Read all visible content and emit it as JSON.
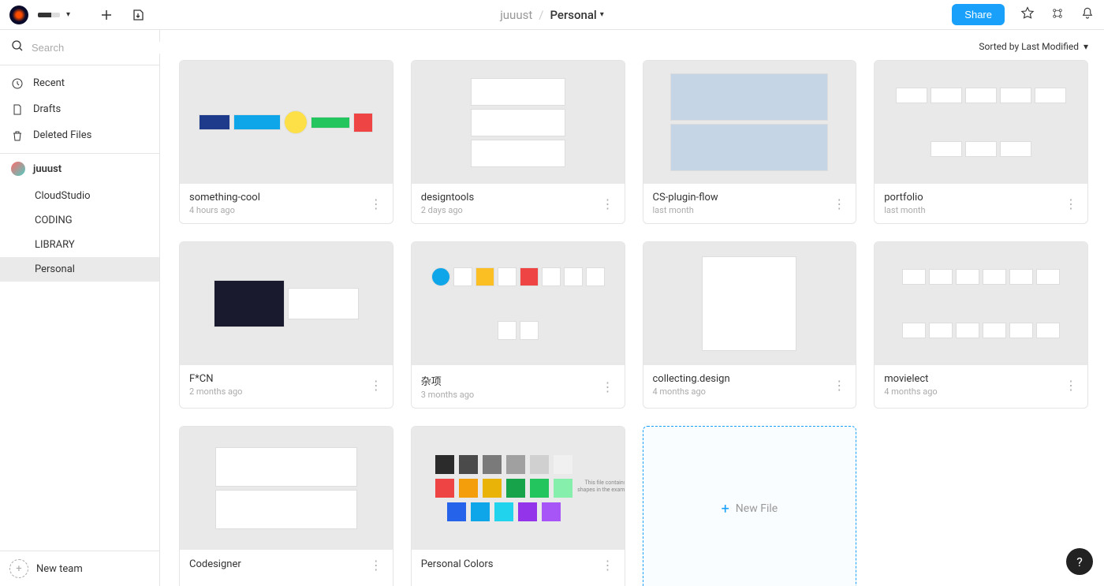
{
  "header": {
    "breadcrumb_user": "juuust",
    "breadcrumb_sep": "/",
    "breadcrumb_folder": "Personal",
    "share_label": "Share"
  },
  "search": {
    "placeholder": "Search"
  },
  "nav": {
    "recent": "Recent",
    "drafts": "Drafts",
    "deleted": "Deleted Files"
  },
  "team": {
    "name": "juuust",
    "projects": [
      {
        "label": "CloudStudio"
      },
      {
        "label": "CODING"
      },
      {
        "label": "LIBRARY"
      },
      {
        "label": "Personal"
      }
    ]
  },
  "sidebar_footer": {
    "new_team": "New team"
  },
  "sort": {
    "label": "Sorted by Last Modified"
  },
  "files": [
    {
      "title": "something-cool",
      "time": "4 hours ago"
    },
    {
      "title": "designtools",
      "time": "2 days ago"
    },
    {
      "title": "CS-plugin-flow",
      "time": "last month"
    },
    {
      "title": "portfolio",
      "time": "last month"
    },
    {
      "title": "F*CN",
      "time": "2 months ago"
    },
    {
      "title": "杂项",
      "time": "3 months ago"
    },
    {
      "title": "collecting.design",
      "time": "4 months ago"
    },
    {
      "title": "movielect",
      "time": "4 months ago"
    },
    {
      "title": "Codesigner",
      "time": ""
    },
    {
      "title": "Personal Colors",
      "time": ""
    }
  ],
  "personal_colors": {
    "caption": "This file contains your Color Styles. They are applied to the shapes in the examples above. You can use them across all your files.",
    "rows": [
      [
        "#2b2b2b",
        "#4a4a4a",
        "#7a7a7a",
        "#a0a0a0",
        "#d0d0d0",
        "#f0f0f0"
      ],
      [
        "#ef4444",
        "#f59e0b",
        "#eab308",
        "#16a34a",
        "#22c55e",
        "#86efac"
      ],
      [
        "#2563eb",
        "#0ea5e9",
        "#22d3ee",
        "#9333ea",
        "#a855f7"
      ]
    ]
  },
  "new_file": {
    "label": "New File"
  },
  "help": {
    "label": "?"
  }
}
